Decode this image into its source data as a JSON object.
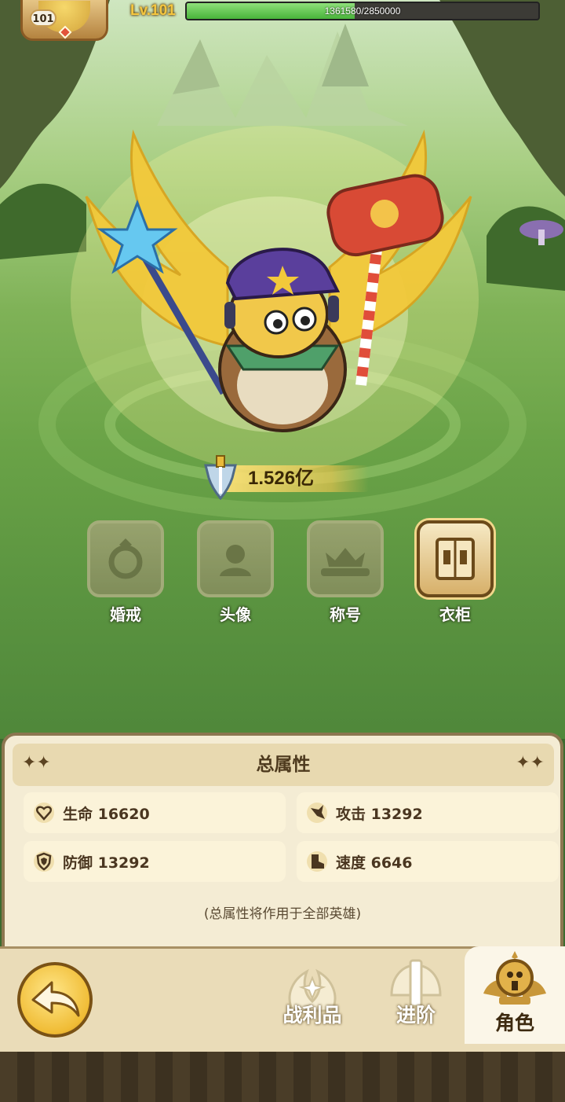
{
  "hud": {
    "avatar_level": "101",
    "level_text": "Lv.101",
    "exp_text": "1361580/2850000",
    "exp_progress": 0.4777
  },
  "power": {
    "value": "1.526亿",
    "icon": "sword-shield-icon"
  },
  "features": [
    {
      "label": "婚戒",
      "icon": "ring-icon",
      "active": false
    },
    {
      "label": "头像",
      "icon": "avatar-icon",
      "active": false
    },
    {
      "label": "称号",
      "icon": "crown-title-icon",
      "active": false
    },
    {
      "label": "衣柜",
      "icon": "wardrobe-icon",
      "active": true
    }
  ],
  "stats_panel": {
    "title": "总属性",
    "stats": [
      {
        "label": "生命 16620",
        "icon": "heart-icon"
      },
      {
        "label": "攻击 13292",
        "icon": "attack-icon"
      },
      {
        "label": "防御 13292",
        "icon": "shield-icon"
      },
      {
        "label": "速度 6646",
        "icon": "boot-icon"
      }
    ],
    "note": "(总属性将作用于全部英雄)"
  },
  "bottom_nav": {
    "back_icon": "back-arrow-icon",
    "items": [
      {
        "label": "战利品",
        "icon": "loot-icon",
        "active": false
      },
      {
        "label": "进阶",
        "icon": "advance-icon",
        "active": false
      },
      {
        "label": "角色",
        "icon": "character-icon",
        "active": true
      }
    ]
  },
  "colors": {
    "accent_gold": "#f4c640",
    "exp_green": "#48b43a",
    "panel_bg": "#f4ecd4"
  }
}
